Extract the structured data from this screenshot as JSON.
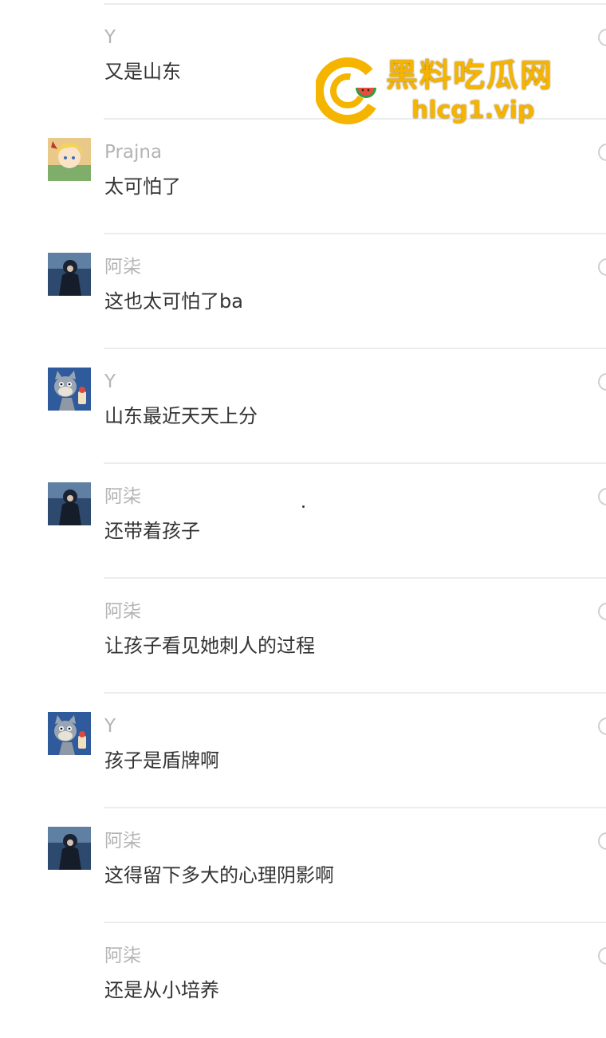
{
  "comments": [
    {
      "username": "Y",
      "text": "又是山东",
      "avatar": "none"
    },
    {
      "username": "Prajna",
      "text": "太可怕了",
      "avatar": "anime-girl-avatar"
    },
    {
      "username": "阿柒",
      "text": "这也太可怕了ba",
      "avatar": "dark-figure-avatar"
    },
    {
      "username": "Y",
      "text": "山东最近天天上分",
      "avatar": "cartoon-cat-avatar"
    },
    {
      "username": "阿柒",
      "text": "还带着孩子",
      "avatar": "dark-figure-avatar"
    },
    {
      "username": "阿柒",
      "text": "让孩子看见她刺人的过程",
      "avatar": "none"
    },
    {
      "username": "Y",
      "text": "孩子是盾牌啊",
      "avatar": "cartoon-cat-avatar"
    },
    {
      "username": "阿柒",
      "text": "这得留下多大的心理阴影啊",
      "avatar": "dark-figure-avatar"
    },
    {
      "username": "阿柒",
      "text": "还是从小培养",
      "avatar": "none"
    }
  ],
  "watermark": {
    "title": "黑料吃瓜网",
    "url": "hlcg1.vip",
    "color": "#f4b400"
  },
  "colors": {
    "username": "#b4b4b4",
    "text": "#333333",
    "divider": "#ececec"
  }
}
